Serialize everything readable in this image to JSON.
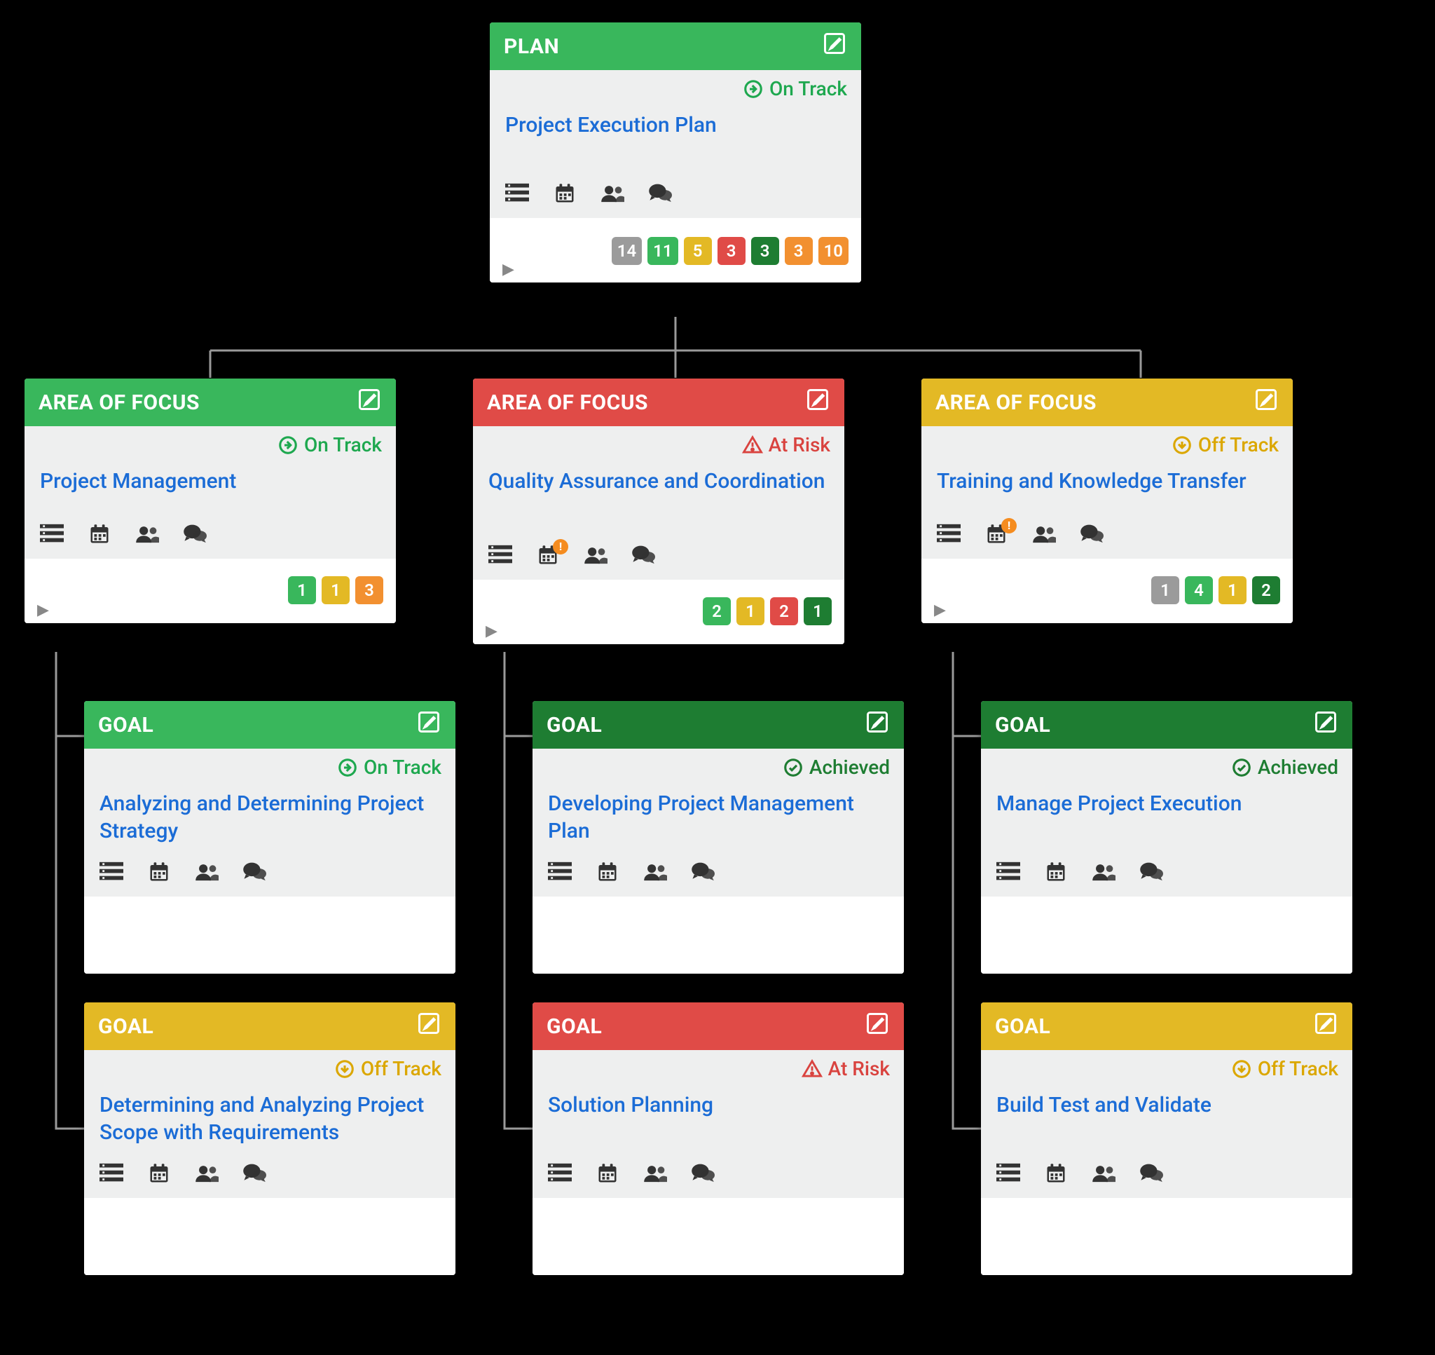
{
  "status_labels": {
    "on_track": "On Track",
    "at_risk": "At Risk",
    "off_track": "Off Track",
    "achieved": "Achieved"
  },
  "plan": {
    "header": "PLAN",
    "status": "on_track",
    "title": "Project Execution Plan",
    "badges": [
      {
        "count": 14,
        "color": "gray"
      },
      {
        "count": 11,
        "color": "green"
      },
      {
        "count": 5,
        "color": "yellow"
      },
      {
        "count": 3,
        "color": "red"
      },
      {
        "count": 3,
        "color": "dgreen"
      },
      {
        "count": 3,
        "color": "orange"
      },
      {
        "count": 10,
        "color": "orange"
      }
    ]
  },
  "areas": [
    {
      "header": "AREA OF FOCUS",
      "status": "on_track",
      "title": "Project Management",
      "calendar_alert": false,
      "badges": [
        {
          "count": 1,
          "color": "green"
        },
        {
          "count": 1,
          "color": "yellow"
        },
        {
          "count": 3,
          "color": "orange"
        }
      ],
      "goals": [
        {
          "header": "GOAL",
          "status": "on_track",
          "title": "Analyzing and Determining Project Strategy"
        },
        {
          "header": "GOAL",
          "status": "off_track",
          "title": "Determining and Analyzing Project Scope with Requirements"
        }
      ]
    },
    {
      "header": "AREA OF FOCUS",
      "status": "at_risk",
      "title": "Quality Assurance and Coordination",
      "calendar_alert": true,
      "badges": [
        {
          "count": 2,
          "color": "green"
        },
        {
          "count": 1,
          "color": "yellow"
        },
        {
          "count": 2,
          "color": "red"
        },
        {
          "count": 1,
          "color": "dgreen"
        }
      ],
      "goals": [
        {
          "header": "GOAL",
          "status": "achieved",
          "title": "Developing Project Management Plan"
        },
        {
          "header": "GOAL",
          "status": "at_risk",
          "title": "Solution Planning"
        }
      ]
    },
    {
      "header": "AREA OF FOCUS",
      "status": "off_track",
      "title": "Training and Knowledge Transfer",
      "calendar_alert": true,
      "badges": [
        {
          "count": 1,
          "color": "gray"
        },
        {
          "count": 4,
          "color": "green"
        },
        {
          "count": 1,
          "color": "yellow"
        },
        {
          "count": 2,
          "color": "dgreen"
        }
      ],
      "goals": [
        {
          "header": "GOAL",
          "status": "achieved",
          "title": "Manage Project Execution"
        },
        {
          "header": "GOAL",
          "status": "off_track",
          "title": "Build Test and Validate"
        }
      ]
    }
  ]
}
